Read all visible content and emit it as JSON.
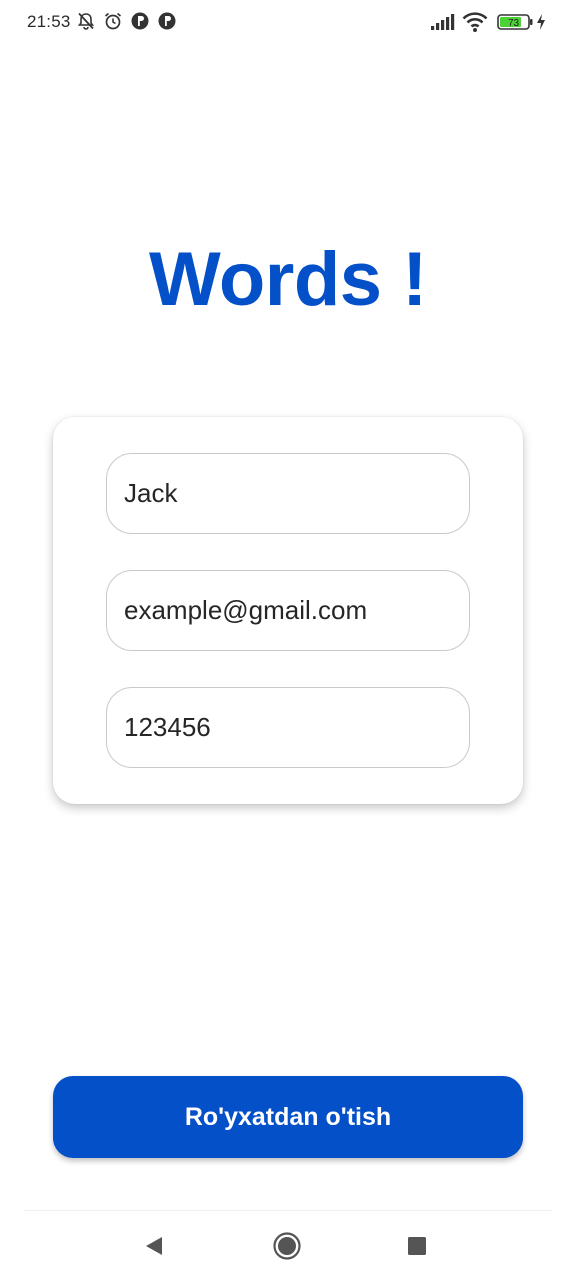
{
  "status_bar": {
    "time": "21:53",
    "icons": [
      "bell-off-icon",
      "alarm-icon",
      "app-notification-icon",
      "app-notification-icon",
      "signal-icon",
      "wifi-icon",
      "battery-icon",
      "charging-icon"
    ],
    "battery_level": "73"
  },
  "app": {
    "title": "Words !",
    "accent_color": "#0450c8"
  },
  "form": {
    "name_value": "Jack",
    "email_value": "example@gmail.com",
    "password_value": "123456"
  },
  "submit": {
    "label": "Ro'yxatdan o'tish"
  },
  "nav_bar": {
    "icons": [
      "back-icon",
      "home-icon",
      "recents-icon"
    ]
  }
}
